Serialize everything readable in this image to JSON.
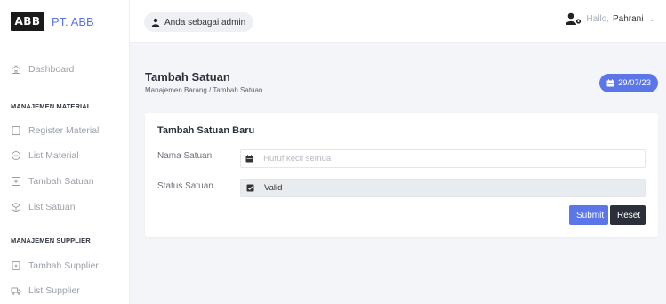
{
  "brand": {
    "logo_text": "ABB",
    "name": "PT. ABB"
  },
  "sidebar": {
    "dashboard": "Dashboard",
    "section_material": "MANAJEMEN MATERIAL",
    "material_items": [
      "Register Material",
      "List Material",
      "Tambah Satuan",
      "List Satuan"
    ],
    "section_supplier": "MANAJEMEN SUPPLIER",
    "supplier_items": [
      "Tambah Supplier",
      "List Supplier"
    ]
  },
  "topbar": {
    "role_label": "Anda sebagai admin",
    "greeting": "Hallo,",
    "username": "Pahrani"
  },
  "page": {
    "title": "Tambah Satuan",
    "breadcrumb": "Manajemen Barang / Tambah Satuan",
    "date": "29/07/23"
  },
  "form": {
    "title": "Tambah Satuan Baru",
    "nama_label": "Nama Satuan",
    "nama_placeholder": "Huruf kecil semua",
    "status_label": "Status Satuan",
    "status_value": "Valid",
    "submit_label": "Submit",
    "reset_label": "Reset"
  },
  "colors": {
    "accent": "#5b76e8",
    "dark_button": "#2a2f3a",
    "background": "#f4f5f9"
  }
}
